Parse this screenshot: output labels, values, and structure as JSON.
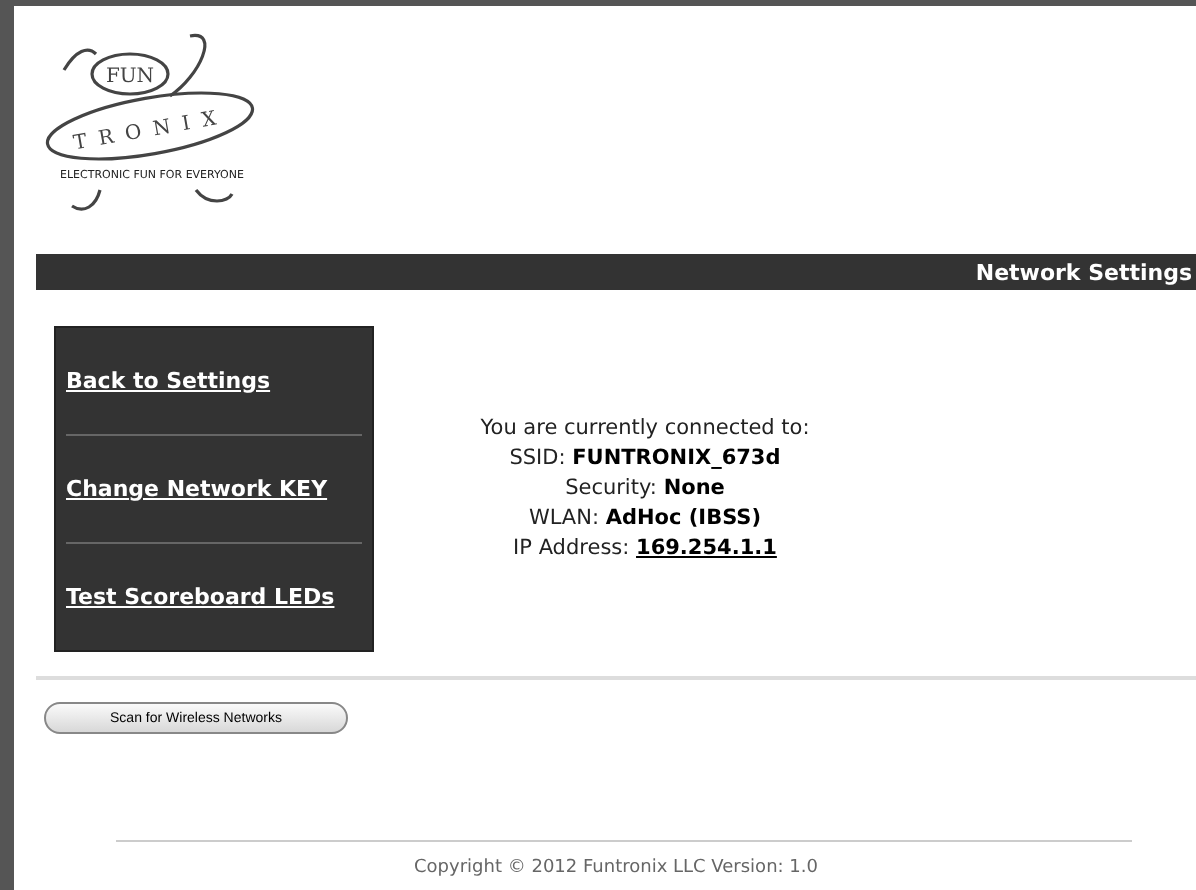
{
  "logo": {
    "top": "FUN",
    "main": "TRONIX",
    "tagline": "ELECTRONIC FUN FOR EVERYONE"
  },
  "header": {
    "title": "Network Settings"
  },
  "sidebar": {
    "items": [
      {
        "label": "Back to Settings"
      },
      {
        "label": "Change Network KEY"
      },
      {
        "label": "Test Scoreboard LEDs"
      }
    ]
  },
  "connection": {
    "heading": "You are currently connected to:",
    "fields": [
      {
        "label": "SSID:",
        "value": "FUNTRONIX_673d",
        "kind": "bold"
      },
      {
        "label": "Security:",
        "value": "None",
        "kind": "bold"
      },
      {
        "label": "WLAN:",
        "value": "AdHoc (IBSS)",
        "kind": "bold"
      },
      {
        "label": "IP Address:",
        "value": "169.254.1.1",
        "kind": "link"
      }
    ]
  },
  "scan_button": {
    "label": "Scan for Wireless Networks"
  },
  "footer": {
    "copyright": "Copyright © 2012 Funtronix LLC Version: 1.0"
  }
}
